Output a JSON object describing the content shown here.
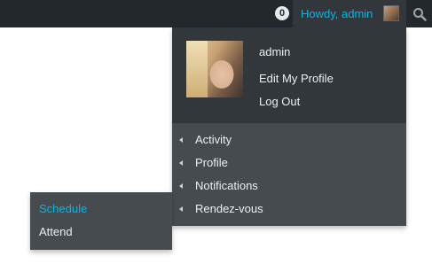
{
  "adminbar": {
    "notification_count": "0",
    "account_label": "Howdy, admin",
    "search_icon": "search-icon"
  },
  "account_menu": {
    "display_name": "admin",
    "edit_profile": "Edit My Profile",
    "log_out": "Log Out",
    "items": [
      {
        "label": "Activity"
      },
      {
        "label": "Profile"
      },
      {
        "label": "Notifications"
      },
      {
        "label": "Rendez-vous"
      }
    ]
  },
  "submenu": {
    "items": [
      {
        "label": "Schedule",
        "active": true
      },
      {
        "label": "Attend",
        "active": false
      }
    ]
  },
  "colors": {
    "bar_bg": "#23282d",
    "menu_bg": "#32373c",
    "submenu_bg": "#464b50",
    "accent": "#00b9eb",
    "text": "#eeeeee"
  }
}
